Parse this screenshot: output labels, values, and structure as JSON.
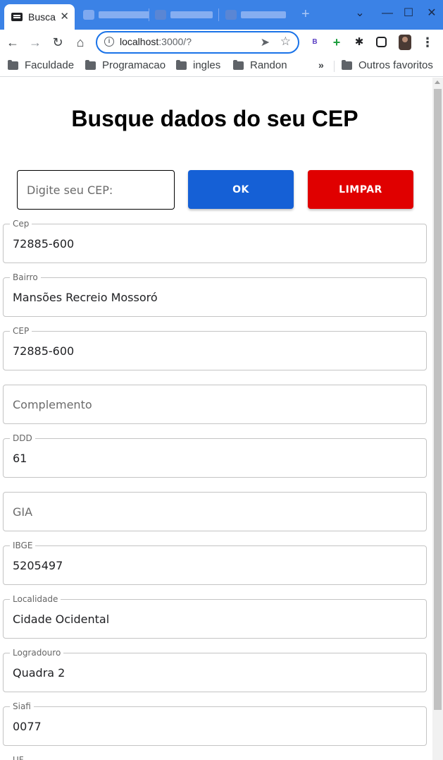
{
  "browser": {
    "active_tab_title": "Busca",
    "url_host": "localhost",
    "url_path": ":3000/?",
    "bookmarks": [
      "Faculdade",
      "Programacao",
      "ingles",
      "Randon"
    ],
    "other_bookmarks": "Outros favoritos",
    "more": "»"
  },
  "page": {
    "title": "Busque dados do seu CEP",
    "cep_input_placeholder": "Digite seu CEP:",
    "ok_label": "OK",
    "clear_label": "LIMPAR",
    "fields": [
      {
        "label": "Cep",
        "value": "72885-600"
      },
      {
        "label": "Bairro",
        "value": "Mansões Recreio Mossoró"
      },
      {
        "label": "CEP",
        "value": "72885-600"
      },
      {
        "label": "",
        "placeholder": "Complemento"
      },
      {
        "label": "DDD",
        "value": "61"
      },
      {
        "label": "",
        "placeholder": "GIA"
      },
      {
        "label": "IBGE",
        "value": "5205497"
      },
      {
        "label": "Localidade",
        "value": "Cidade Ocidental"
      },
      {
        "label": "Logradouro",
        "value": "Quadra 2"
      },
      {
        "label": "Siafi",
        "value": "0077"
      }
    ],
    "next_field_label": "UF"
  },
  "colors": {
    "ok_button": "#1560d6",
    "clear_button": "#e00000",
    "tabstrip": "#3b82e6"
  }
}
